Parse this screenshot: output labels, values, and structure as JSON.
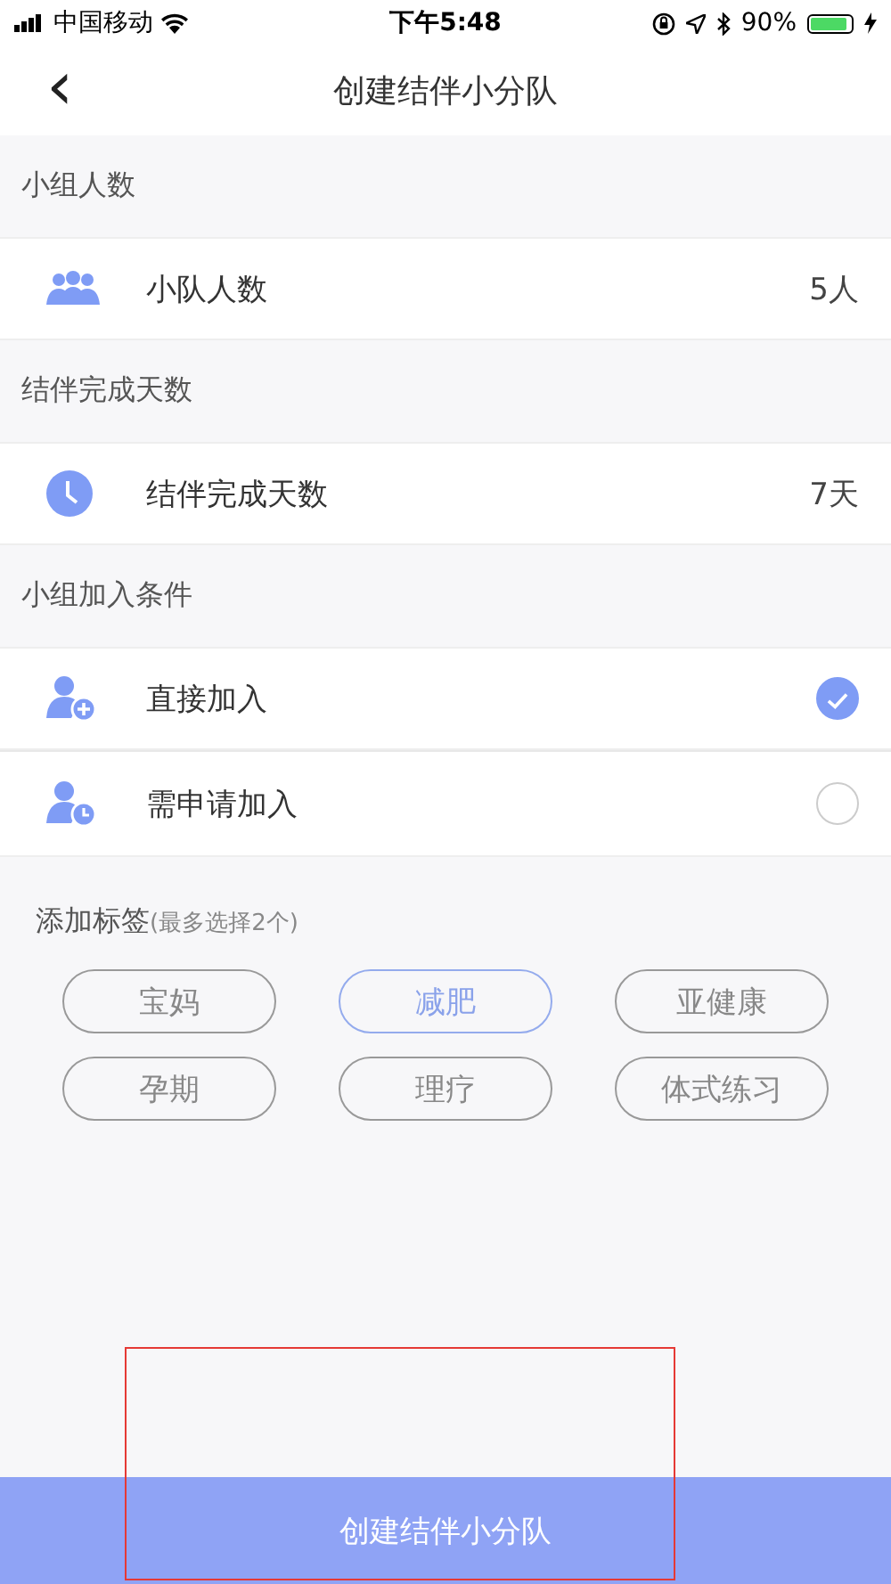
{
  "status_bar": {
    "carrier": "中国移动",
    "time": "下午5:48",
    "battery": "90%"
  },
  "nav": {
    "back": "‹",
    "title": "创建结伴小分队"
  },
  "sections": [
    {
      "header": "小组人数",
      "rows": [
        {
          "kind": "value",
          "label": "小队人数",
          "value": "5人"
        }
      ]
    },
    {
      "header": "结伴完成天数",
      "rows": [
        {
          "kind": "value",
          "label": "结伴完成天数",
          "value": "7天"
        }
      ]
    },
    {
      "header": "小组加入条件",
      "rows": [
        {
          "kind": "radio",
          "label": "直接加入",
          "selected": true
        },
        {
          "kind": "radio",
          "label": "需申请加入",
          "selected": false
        }
      ]
    }
  ],
  "tags": {
    "title": "添加标签",
    "hint": "(最多选择2个)",
    "items": [
      {
        "label": "宝妈",
        "selected": false
      },
      {
        "label": "减肥",
        "selected": true
      },
      {
        "label": "亚健康",
        "selected": false
      },
      {
        "label": "孕期",
        "selected": false
      },
      {
        "label": "理疗",
        "selected": false
      },
      {
        "label": "体式练习",
        "selected": false
      }
    ]
  },
  "submit": "创建结伴小分队"
}
